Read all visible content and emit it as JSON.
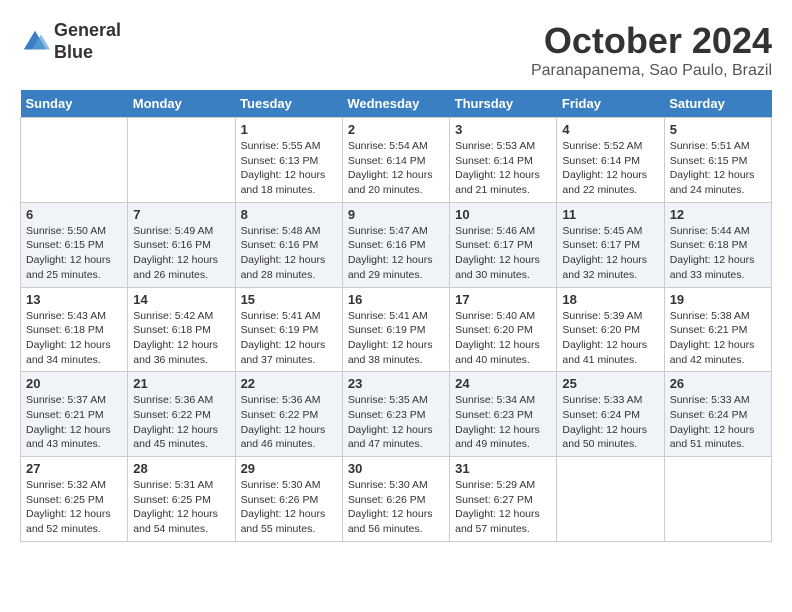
{
  "header": {
    "logo_line1": "General",
    "logo_line2": "Blue",
    "month": "October 2024",
    "location": "Paranapanema, Sao Paulo, Brazil"
  },
  "weekdays": [
    "Sunday",
    "Monday",
    "Tuesday",
    "Wednesday",
    "Thursday",
    "Friday",
    "Saturday"
  ],
  "weeks": [
    [
      {
        "day": "",
        "info": ""
      },
      {
        "day": "",
        "info": ""
      },
      {
        "day": "1",
        "info": "Sunrise: 5:55 AM\nSunset: 6:13 PM\nDaylight: 12 hours and 18 minutes."
      },
      {
        "day": "2",
        "info": "Sunrise: 5:54 AM\nSunset: 6:14 PM\nDaylight: 12 hours and 20 minutes."
      },
      {
        "day": "3",
        "info": "Sunrise: 5:53 AM\nSunset: 6:14 PM\nDaylight: 12 hours and 21 minutes."
      },
      {
        "day": "4",
        "info": "Sunrise: 5:52 AM\nSunset: 6:14 PM\nDaylight: 12 hours and 22 minutes."
      },
      {
        "day": "5",
        "info": "Sunrise: 5:51 AM\nSunset: 6:15 PM\nDaylight: 12 hours and 24 minutes."
      }
    ],
    [
      {
        "day": "6",
        "info": "Sunrise: 5:50 AM\nSunset: 6:15 PM\nDaylight: 12 hours and 25 minutes."
      },
      {
        "day": "7",
        "info": "Sunrise: 5:49 AM\nSunset: 6:16 PM\nDaylight: 12 hours and 26 minutes."
      },
      {
        "day": "8",
        "info": "Sunrise: 5:48 AM\nSunset: 6:16 PM\nDaylight: 12 hours and 28 minutes."
      },
      {
        "day": "9",
        "info": "Sunrise: 5:47 AM\nSunset: 6:16 PM\nDaylight: 12 hours and 29 minutes."
      },
      {
        "day": "10",
        "info": "Sunrise: 5:46 AM\nSunset: 6:17 PM\nDaylight: 12 hours and 30 minutes."
      },
      {
        "day": "11",
        "info": "Sunrise: 5:45 AM\nSunset: 6:17 PM\nDaylight: 12 hours and 32 minutes."
      },
      {
        "day": "12",
        "info": "Sunrise: 5:44 AM\nSunset: 6:18 PM\nDaylight: 12 hours and 33 minutes."
      }
    ],
    [
      {
        "day": "13",
        "info": "Sunrise: 5:43 AM\nSunset: 6:18 PM\nDaylight: 12 hours and 34 minutes."
      },
      {
        "day": "14",
        "info": "Sunrise: 5:42 AM\nSunset: 6:18 PM\nDaylight: 12 hours and 36 minutes."
      },
      {
        "day": "15",
        "info": "Sunrise: 5:41 AM\nSunset: 6:19 PM\nDaylight: 12 hours and 37 minutes."
      },
      {
        "day": "16",
        "info": "Sunrise: 5:41 AM\nSunset: 6:19 PM\nDaylight: 12 hours and 38 minutes."
      },
      {
        "day": "17",
        "info": "Sunrise: 5:40 AM\nSunset: 6:20 PM\nDaylight: 12 hours and 40 minutes."
      },
      {
        "day": "18",
        "info": "Sunrise: 5:39 AM\nSunset: 6:20 PM\nDaylight: 12 hours and 41 minutes."
      },
      {
        "day": "19",
        "info": "Sunrise: 5:38 AM\nSunset: 6:21 PM\nDaylight: 12 hours and 42 minutes."
      }
    ],
    [
      {
        "day": "20",
        "info": "Sunrise: 5:37 AM\nSunset: 6:21 PM\nDaylight: 12 hours and 43 minutes."
      },
      {
        "day": "21",
        "info": "Sunrise: 5:36 AM\nSunset: 6:22 PM\nDaylight: 12 hours and 45 minutes."
      },
      {
        "day": "22",
        "info": "Sunrise: 5:36 AM\nSunset: 6:22 PM\nDaylight: 12 hours and 46 minutes."
      },
      {
        "day": "23",
        "info": "Sunrise: 5:35 AM\nSunset: 6:23 PM\nDaylight: 12 hours and 47 minutes."
      },
      {
        "day": "24",
        "info": "Sunrise: 5:34 AM\nSunset: 6:23 PM\nDaylight: 12 hours and 49 minutes."
      },
      {
        "day": "25",
        "info": "Sunrise: 5:33 AM\nSunset: 6:24 PM\nDaylight: 12 hours and 50 minutes."
      },
      {
        "day": "26",
        "info": "Sunrise: 5:33 AM\nSunset: 6:24 PM\nDaylight: 12 hours and 51 minutes."
      }
    ],
    [
      {
        "day": "27",
        "info": "Sunrise: 5:32 AM\nSunset: 6:25 PM\nDaylight: 12 hours and 52 minutes."
      },
      {
        "day": "28",
        "info": "Sunrise: 5:31 AM\nSunset: 6:25 PM\nDaylight: 12 hours and 54 minutes."
      },
      {
        "day": "29",
        "info": "Sunrise: 5:30 AM\nSunset: 6:26 PM\nDaylight: 12 hours and 55 minutes."
      },
      {
        "day": "30",
        "info": "Sunrise: 5:30 AM\nSunset: 6:26 PM\nDaylight: 12 hours and 56 minutes."
      },
      {
        "day": "31",
        "info": "Sunrise: 5:29 AM\nSunset: 6:27 PM\nDaylight: 12 hours and 57 minutes."
      },
      {
        "day": "",
        "info": ""
      },
      {
        "day": "",
        "info": ""
      }
    ]
  ]
}
